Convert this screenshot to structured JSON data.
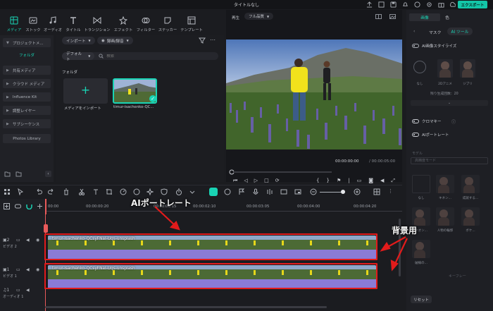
{
  "window": {
    "title": "タイトルなし",
    "export_label": "エクスポート"
  },
  "media_tabs": [
    {
      "label": "メディア",
      "icon": "media-icon",
      "active": true
    },
    {
      "label": "ストック",
      "icon": "stock-icon"
    },
    {
      "label": "オーディオ",
      "icon": "audio-icon"
    },
    {
      "label": "タイトル",
      "icon": "title-icon"
    },
    {
      "label": "トランジション",
      "icon": "transition-icon"
    },
    {
      "label": "エフェクト",
      "icon": "effect-icon"
    },
    {
      "label": "フィルター",
      "icon": "filter-icon"
    },
    {
      "label": "ステッカー",
      "icon": "sticker-icon"
    },
    {
      "label": "テンプレート",
      "icon": "template-icon"
    }
  ],
  "sidebar": {
    "items": [
      {
        "label": "プロジェクトメ..."
      },
      {
        "label": "フォルダ",
        "selected": true
      },
      {
        "label": "共有メディア"
      },
      {
        "label": "クラウド メディア"
      },
      {
        "label": "Influence Kit"
      },
      {
        "label": "調整レイヤー"
      },
      {
        "label": "サブシーケンス"
      },
      {
        "label": "Photos Library"
      }
    ]
  },
  "media": {
    "import_label": "インポート",
    "record_label": "録画/録音",
    "default_label": "デフォルト",
    "search_placeholder": "検索",
    "folder_title": "フォルダ",
    "import_card_label": "メディアをインポート",
    "clip_card_label": "timur-isachenko-QC..."
  },
  "player": {
    "playback_label": "再生",
    "quality_label": "フル品質",
    "time_current": "00:00:00:00",
    "time_total": "/ 00:00:05:00"
  },
  "right_panel": {
    "tabs": [
      "画像",
      "色"
    ],
    "subtabs": [
      "マスク",
      "AI ツール"
    ],
    "ai_style_label": "AI画像スタイライズ",
    "style_none": "なし",
    "style_1": "2Dアニメ",
    "style_2": "ジブリ",
    "remaining_label": "残り生成回数：20",
    "chroma_label": "クロマキー",
    "ai_portrait_label": "AIポートレート",
    "model_label": "モデル",
    "model_select": "高精度モード",
    "portrait_labels": [
      "なし",
      "キネン...",
      "成就する...",
      "ネオン...",
      "人物の輪郭",
      "ボケ...",
      "破線の..."
    ],
    "reset_label": "リセット",
    "keyframe_label": "キーフレー"
  },
  "timeline": {
    "ticks": [
      "00:00",
      "00:00:00:20",
      "00:00:01:15",
      "00:00:02:10",
      "00:00:03:05",
      "00:00:04:00",
      "00:00:04:20"
    ],
    "clip_name": "timur-isachenko-QCsyFNaI-Uqs-unsplash",
    "track_video2": "ビデオ 2",
    "track_video1": "ビデオ 1",
    "track_audio1": "オーディオ 1"
  },
  "annotations": {
    "top_label": "AIポートレート",
    "right_label": "背景用"
  },
  "colors": {
    "accent": "#19d3b4",
    "export": "#13c6a8",
    "clip": "#8a7bd6",
    "annotation_border": "#e21b1b"
  }
}
